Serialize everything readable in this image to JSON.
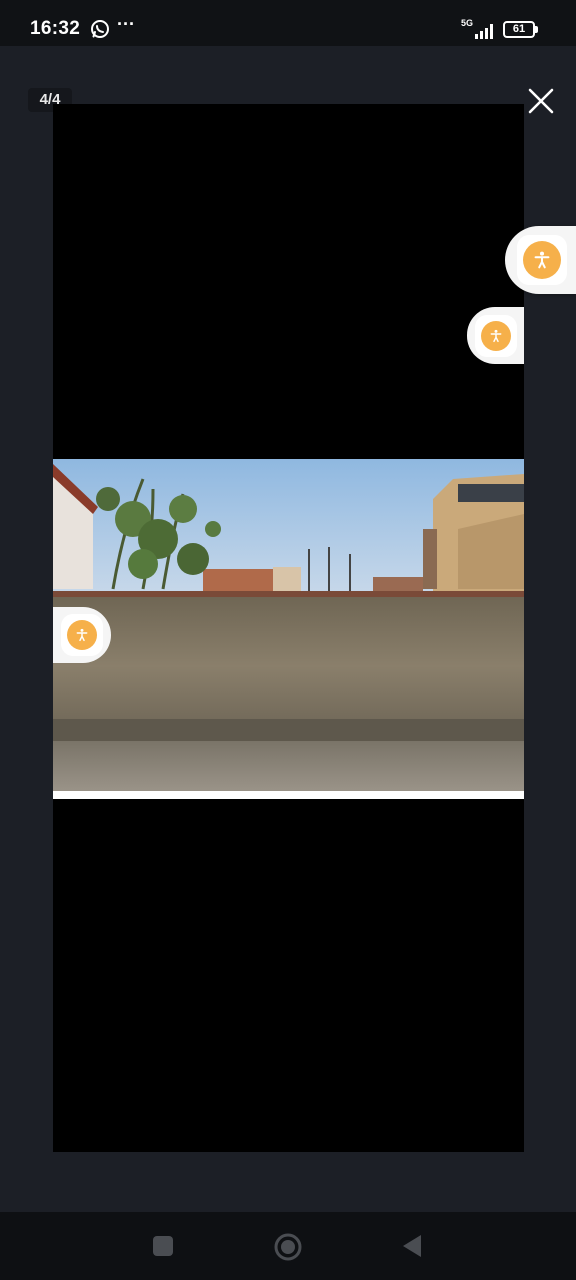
{
  "status_bar": {
    "time": "16:32",
    "network": "5G",
    "battery": "61",
    "icons": [
      "whatsapp-icon",
      "more-dots-icon",
      "signal-icon",
      "battery-icon"
    ]
  },
  "viewer": {
    "counter": "4/4",
    "close_icon": "close-icon",
    "image_icon": "photo-wall-street-scene"
  },
  "accessibility_buttons": {
    "icon": "accessibility-person-icon",
    "color": "#f6b04a"
  },
  "nav_bar": {
    "buttons": [
      "recents-button",
      "home-button",
      "back-button"
    ]
  }
}
